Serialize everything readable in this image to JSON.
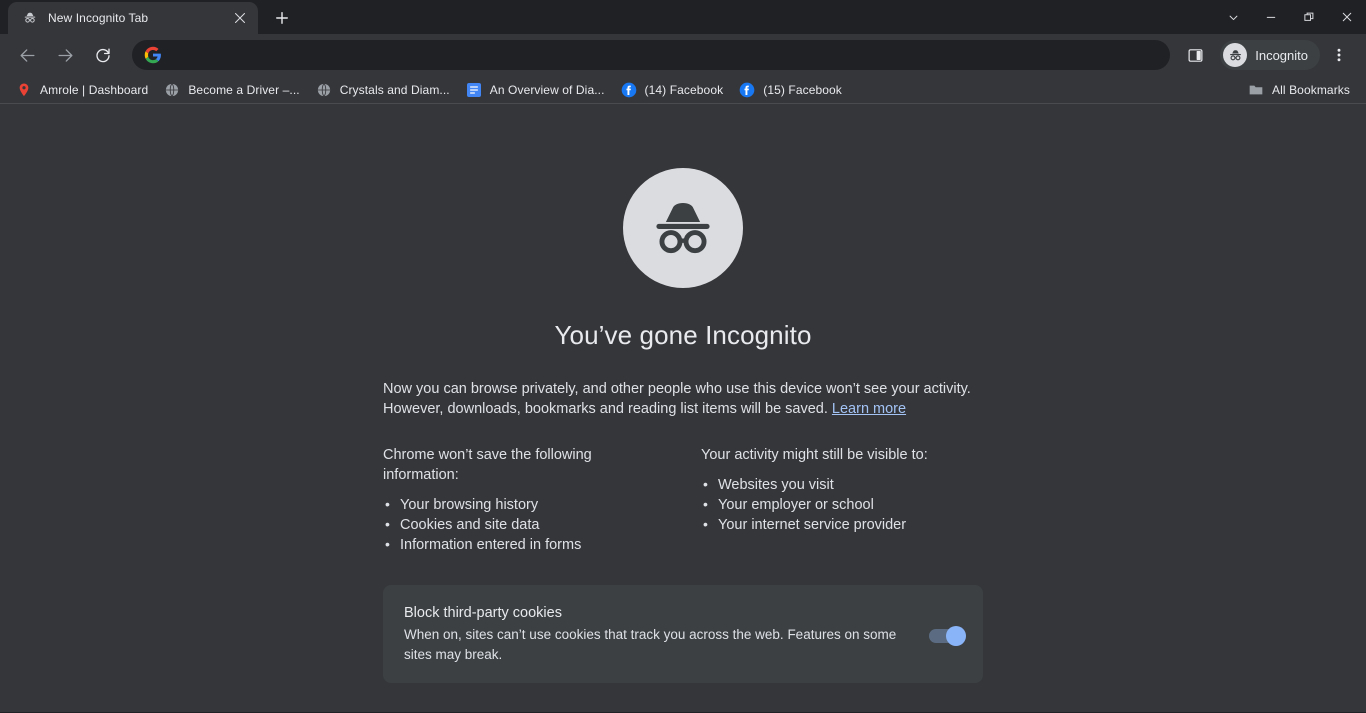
{
  "window": {
    "controls": [
      {
        "name": "tab-search",
        "glyph": "chevron-down-icon"
      },
      {
        "name": "minimize",
        "glyph": "minimize-icon"
      },
      {
        "name": "restore",
        "glyph": "restore-icon"
      },
      {
        "name": "close",
        "glyph": "close-icon"
      }
    ]
  },
  "tabstrip": {
    "tabs": [
      {
        "title": "New Incognito Tab",
        "favicon": "incognito-icon",
        "active": true
      }
    ],
    "new_tab_label": "+"
  },
  "toolbar": {
    "back_label": "Back",
    "forward_label": "Forward",
    "reload_label": "Reload",
    "omnibox": {
      "value": "",
      "placeholder": "",
      "icon": "google-g-icon"
    },
    "side_panel_label": "Side panel",
    "profile_label": "Incognito",
    "menu_label": "Customize and control Google Chrome"
  },
  "bookmarks": {
    "items": [
      {
        "label": "Amrole | Dashboard",
        "icon": "map-pin-icon"
      },
      {
        "label": "Become a Driver –...",
        "icon": "globe-icon"
      },
      {
        "label": "Crystals and Diam...",
        "icon": "globe-icon"
      },
      {
        "label": "An Overview of Dia...",
        "icon": "document-icon"
      },
      {
        "label": "(14) Facebook",
        "icon": "facebook-icon"
      },
      {
        "label": "(15) Facebook",
        "icon": "facebook-icon"
      }
    ],
    "all_bookmarks_label": "All Bookmarks",
    "all_bookmarks_icon": "folder-icon"
  },
  "ntp": {
    "avatar_icon": "incognito-avatar-icon",
    "title": "You’ve gone Incognito",
    "paragraph": "Now you can browse privately, and other people who use this device won’t see your activity. However, downloads, bookmarks and reading list items will be saved. ",
    "learn_more_label": "Learn more",
    "columns": [
      {
        "heading": "Chrome won’t save the following information:",
        "items": [
          "Your browsing history",
          "Cookies and site data",
          "Information entered in forms"
        ]
      },
      {
        "heading": "Your activity might still be visible to:",
        "items": [
          "Websites you visit",
          "Your employer or school",
          "Your internet service provider"
        ]
      }
    ],
    "card": {
      "title": "Block third-party cookies",
      "description": "When on, sites can’t use cookies that track you across the web. Features on some sites may break.",
      "toggle_on": true,
      "toggle_accent": "#8ab4f8"
    }
  },
  "colors": {
    "window_bg": "#202124",
    "toolbar_bg": "#35363a",
    "card_bg": "#3c4043",
    "text": "#e8eaed",
    "link": "#a3c3f5",
    "avatar_bg": "#dadce0"
  }
}
